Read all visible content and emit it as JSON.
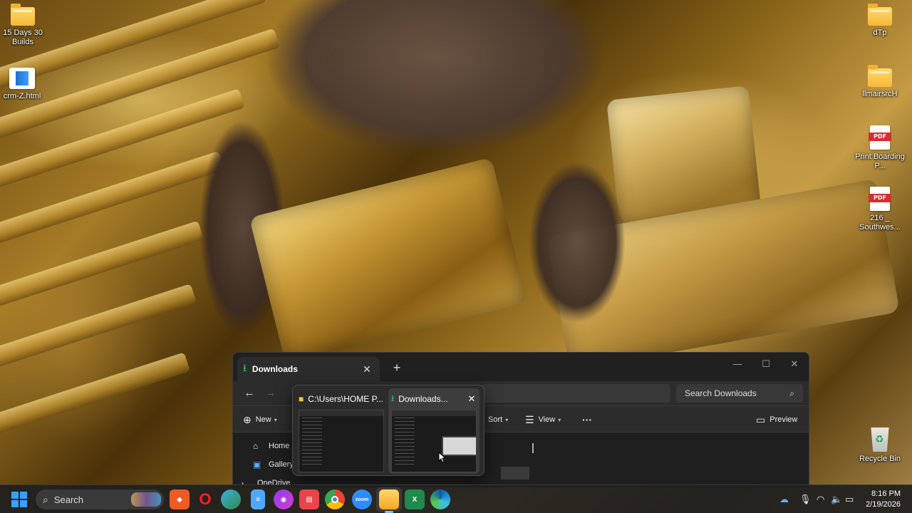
{
  "desktop": {
    "icons_left": [
      {
        "name": "desktop-icon-15-days-30-builds",
        "label": "15 Days 30 Builds",
        "type": "folder"
      },
      {
        "name": "desktop-icon-crm-z-html",
        "label": "crm-Z.html",
        "type": "html"
      }
    ],
    "icons_right": [
      {
        "name": "desktop-icon-dtp",
        "label": "dTp",
        "type": "folder"
      },
      {
        "name": "desktop-icon-llmairsrch",
        "label": "llmairsrcH",
        "type": "folder"
      },
      {
        "name": "desktop-icon-print-boarding-pass",
        "label": "Print Boarding P...",
        "type": "pdf"
      },
      {
        "name": "desktop-icon-216-southwest",
        "label": "216 _ Southwes...",
        "type": "pdf"
      },
      {
        "name": "desktop-icon-recycle-bin",
        "label": "Recycle Bin",
        "type": "recycle"
      }
    ],
    "pdf_badge": "PDF"
  },
  "explorer": {
    "tab_label": "Downloads",
    "search_placeholder": "Search Downloads",
    "toolbar": {
      "new_label": "New",
      "sort_label": "Sort",
      "view_label": "View",
      "more_label": "···",
      "preview_label": "Preview"
    },
    "sidebar": [
      {
        "label": "Home"
      },
      {
        "label": "Gallery"
      },
      {
        "label": "OneDrive"
      }
    ]
  },
  "preview_popup": {
    "items": [
      {
        "label": "C:\\Users\\HOME P...",
        "icon": "folder-icon"
      },
      {
        "label": "Downloads...",
        "icon": "download-icon"
      }
    ]
  },
  "taskbar": {
    "search_label": "Search",
    "apps": [
      "brave-icon",
      "opera-icon",
      "browser-globe-icon",
      "notepad-icon",
      "copilot-icon",
      "app-icon",
      "chrome-icon",
      "zoom-icon",
      "file-explorer-icon",
      "excel-icon",
      "edge-icon"
    ],
    "zoom_text": "zoom",
    "time": "8:16 PM",
    "date": "2/19/2026"
  },
  "colors": {
    "accent": "#3aa0ff",
    "download_green": "#37c871",
    "window_bg": "#1f1f1f"
  }
}
